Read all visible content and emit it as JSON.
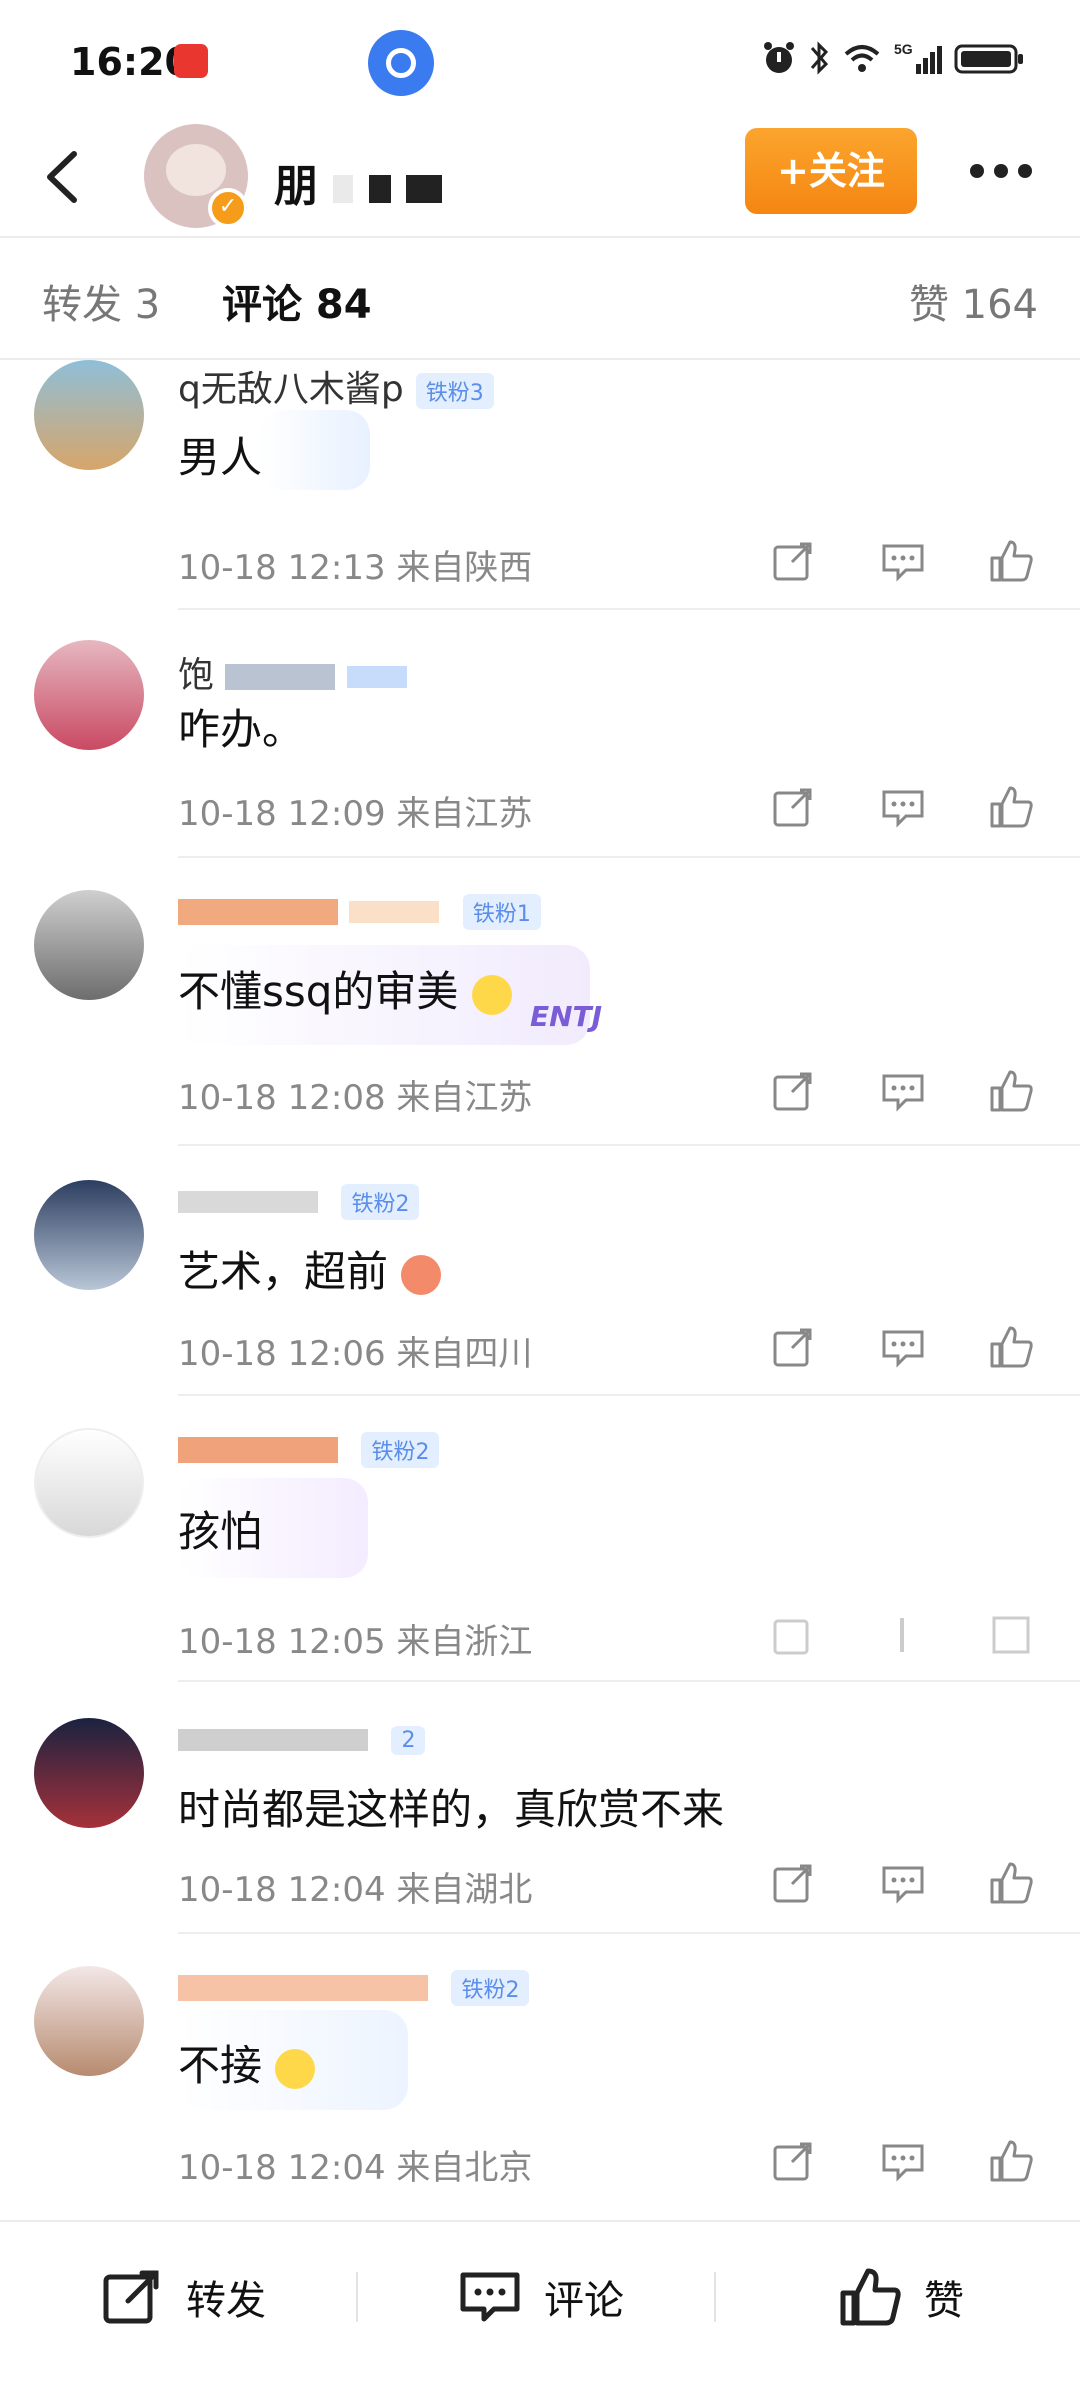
{
  "status_bar": {
    "time": "16:20"
  },
  "header": {
    "author_name": "朋",
    "follow_label": "+关注"
  },
  "tabs": {
    "repost": "转发 3",
    "comments": "评论 84",
    "likes": "赞 164"
  },
  "comments": [
    {
      "name": "q无敌八木酱p",
      "fan_badge": "铁粉3",
      "text": "男人",
      "meta": "10-18 12:13  来自陕西"
    },
    {
      "name": "饱",
      "fan_badge": "",
      "text": "咋办。",
      "meta": "10-18 12:09  来自江苏"
    },
    {
      "name": "",
      "fan_badge": "铁粉1",
      "text": "不懂ssq的审美",
      "meta": "10-18 12:08  来自江苏"
    },
    {
      "name": "",
      "fan_badge": "铁粉2",
      "text": "艺术，超前",
      "meta": "10-18 12:06  来自四川"
    },
    {
      "name": "",
      "fan_badge": "铁粉2",
      "text": "孩怕",
      "meta": "10-18 12:05  来自浙江"
    },
    {
      "name": "",
      "fan_badge": "2",
      "text": "时尚都是这样的，真欣赏不来",
      "meta": "10-18 12:04  来自湖北"
    },
    {
      "name": "",
      "fan_badge": "铁粉2",
      "text": "不接",
      "meta": "10-18 12:04  来自北京"
    }
  ],
  "sticker_text": "ENTJ",
  "bottom_bar": {
    "repost": "转发",
    "comment": "评论",
    "like": "赞"
  },
  "colors": {
    "accent_orange": "#f58611",
    "fan_badge_blue": "#5a8eea"
  }
}
